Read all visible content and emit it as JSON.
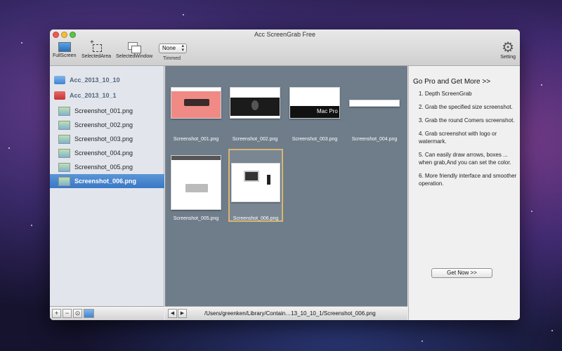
{
  "window": {
    "title": "Acc ScreenGrab Free"
  },
  "toolbar": {
    "fullscreen_label": "FullScreen",
    "selectedarea_label": "SelectedArea",
    "selectedwindow_label": "SelectedWindow",
    "timmed_value": "None",
    "timmed_label": "Timmed",
    "setting_label": "Setting"
  },
  "sidebar": {
    "folders": [
      {
        "label": "Acc_2013_10_10",
        "icon": "folder-blue-icon"
      },
      {
        "label": "Acc_2013_10_1",
        "icon": "folder-red-icon"
      }
    ],
    "files": [
      {
        "label": "Screenshot_001.png"
      },
      {
        "label": "Screenshot_002.png"
      },
      {
        "label": "Screenshot_003.png"
      },
      {
        "label": "Screenshot_004.png"
      },
      {
        "label": "Screenshot_005.png"
      },
      {
        "label": "Screenshot_006.png"
      }
    ],
    "selected_index": 5,
    "footer_buttons": [
      "+",
      "−",
      "⊙"
    ]
  },
  "gallery": {
    "thumbs": [
      {
        "caption": "Screenshot_001.png"
      },
      {
        "caption": "Screenshot_002.png"
      },
      {
        "caption": "Screenshot_003.png"
      },
      {
        "caption": "Screenshot_004.png"
      },
      {
        "caption": "Screenshot_005.png"
      },
      {
        "caption": "Screenshot_006.png"
      }
    ],
    "path": "/Users/greenken/Library/Contain…13_10_10_1/Screenshot_006.png",
    "nav_prev": "◀",
    "nav_next": "▶"
  },
  "promo": {
    "title": "Go Pro and Get More >>",
    "items": [
      "1. Depth ScreenGrab",
      "2. Grab the specified size screenshot.",
      "3. Grab the round Comers screenshot.",
      "4. Grab screenshot with logo or watermark.",
      "5. Can easily draw arrows, boxes ... when grab,And you can set the color.",
      "6. More friendly interface and smoother operation."
    ],
    "button": "Get Now >>"
  },
  "colors": {
    "selection": "#3a78c5",
    "gallery_bg": "#6f7d8a",
    "selected_thumb_border": "#d8b571"
  }
}
